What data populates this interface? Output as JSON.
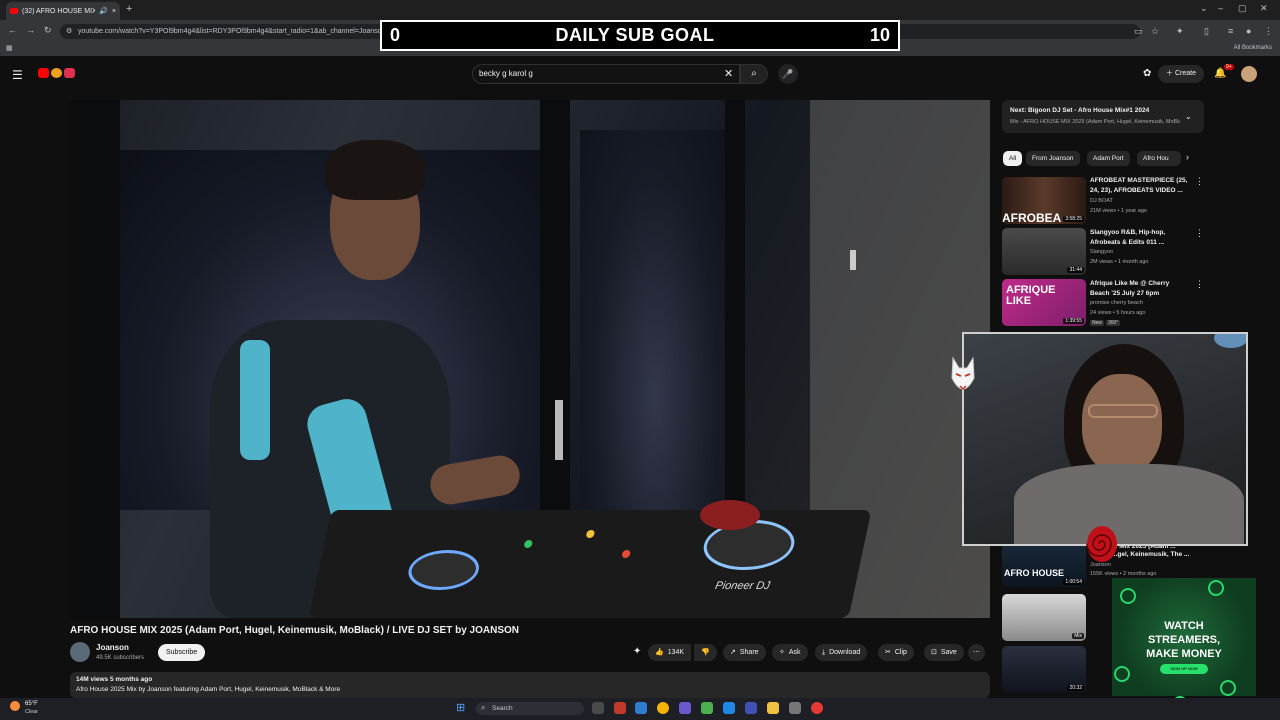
{
  "browser": {
    "tab_title": "(32) AFRO HOUSE MIX 2025",
    "url": "youtube.com/watch?v=Y3POl9bm4g4&list=RDY3POl9bm4g4&start_radio=1&ab_channel=Joanson",
    "bookmarks_label": "All Bookmarks",
    "new_tab": "+",
    "close": "×"
  },
  "sub_goal": {
    "current": "0",
    "label": "DAILY SUB GOAL",
    "target": "10"
  },
  "masthead": {
    "search_value": "becky g karol g",
    "create_label": "Create",
    "notif_count": "9+"
  },
  "video": {
    "title": "AFRO HOUSE MIX 2025 (Adam Port, Hugel, Keinemusik, MoBlack) / LIVE DJ SET by JOANSON",
    "decks_brand": "Pioneer DJ",
    "channel": {
      "name": "Joanson",
      "subscribers": "49.5K subscribers",
      "subscribe_label": "Subscribe"
    },
    "actions": {
      "likes": "134K",
      "share": "Share",
      "ask": "Ask",
      "download": "Download",
      "clip": "Clip",
      "save": "Save"
    },
    "description": {
      "stats": "14M views  5 months ago",
      "text": "Afro House 2025 Mix by Joanson featuring Adam Port, Hugel, Keinemusik, MoBlack & More"
    }
  },
  "sidebar": {
    "next": {
      "title": "Next: Bigoon DJ Set - Afro House Mix#1 2024",
      "subtitle": "Mix - AFRO HOUSE MIX 2025 (Adam Port, Hugel, Keinemusik, MoBlack)"
    },
    "chips": [
      "All",
      "From Joanson",
      "Adam Port",
      "Afro Hou"
    ],
    "videos": [
      {
        "title": "AFROBEAT MASTERPIECE (25, 24, 23), AFROBEATS VIDEO ...",
        "channel": "DJ BOAT",
        "meta": "21M views • 1 year ago",
        "duration": "3:58:25",
        "thumb_text": "AFROBEA"
      },
      {
        "title": "Slangyoo R&B, Hip-hop, Afrobeats & Edits 011 ...",
        "channel": "Slangyoo",
        "meta": "2M views • 1 month ago",
        "duration": "31:44"
      },
      {
        "title": "Afrique Like Me @ Cherry Beach '25 July 27 6pm",
        "channel": "promise cherry beach",
        "meta": "24 views • 5 hours ago",
        "duration": "1:39:55",
        "badges": [
          "New",
          "360°"
        ],
        "thumb_text": "AFRIQUE LIKE"
      },
      {
        "title": "... Mix 2025 (Adam ...",
        "subtitle": "...gel, Keinemusik, The ...",
        "channel": "Joanson",
        "meta": "155K views • 2 months ago",
        "duration": "1:00:54",
        "thumb_text": "AFRO HOUSE"
      },
      {
        "duration": "Mix"
      },
      {
        "duration": "20:32"
      }
    ]
  },
  "ad": {
    "line1": "WATCH",
    "line2": "STREAMERS,",
    "line3": "MAKE MONEY",
    "cta": "SIGN UP NOW"
  },
  "taskbar": {
    "temperature": "65°F",
    "condition": "Clear",
    "search_placeholder": "Search"
  },
  "colors": {
    "youtube_red": "#ff0000",
    "background": "#0f0f0f",
    "ad_green": "#27e06c"
  }
}
